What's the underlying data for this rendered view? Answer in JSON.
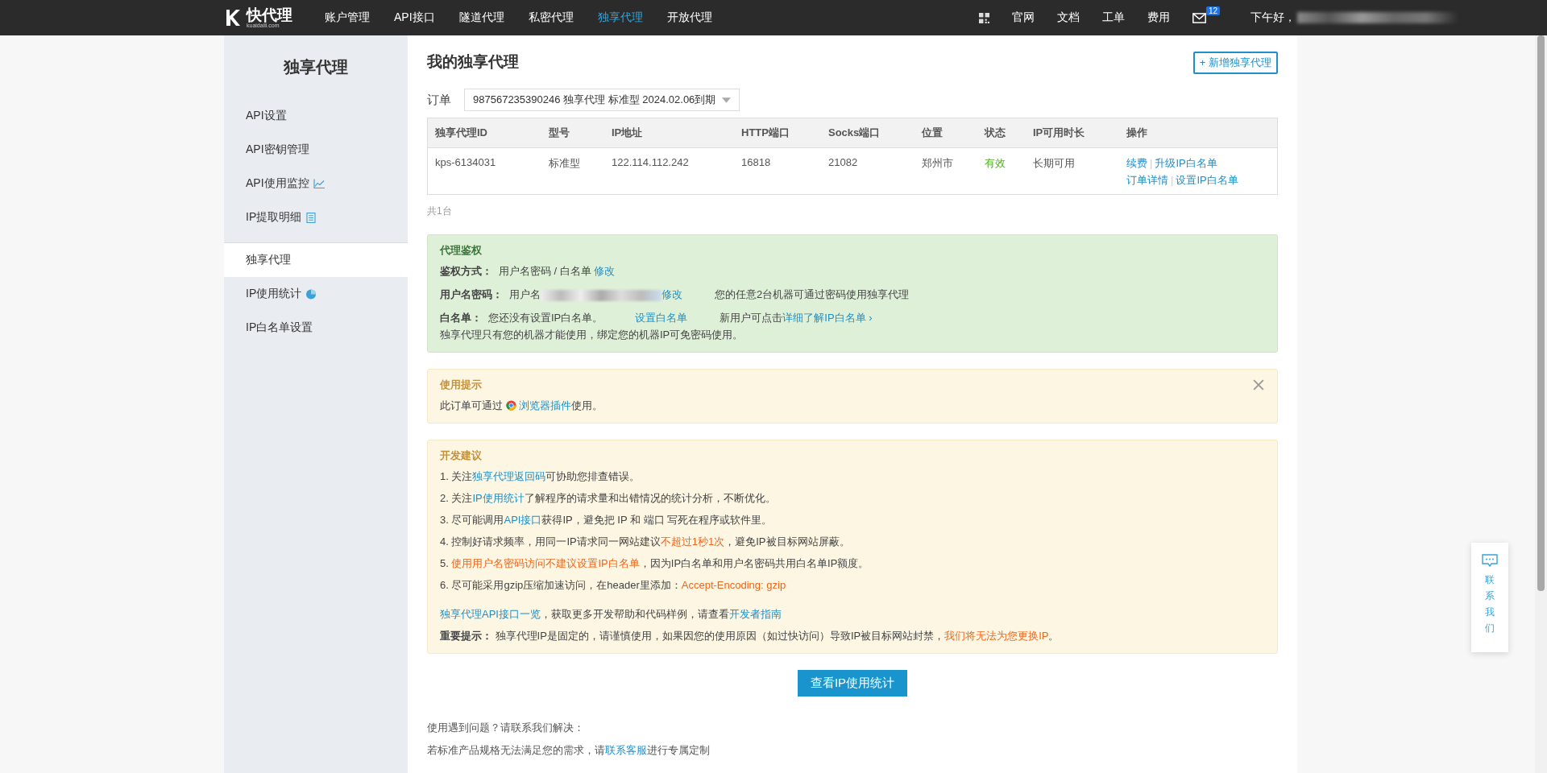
{
  "nav": {
    "logo": {
      "name": "快代理",
      "sub": "kuaidaili.com"
    },
    "menu": [
      {
        "label": "账户管理",
        "selected": false
      },
      {
        "label": "API接口",
        "selected": false
      },
      {
        "label": "隧道代理",
        "selected": false
      },
      {
        "label": "私密代理",
        "selected": false
      },
      {
        "label": "独享代理",
        "selected": true
      },
      {
        "label": "开放代理",
        "selected": false
      }
    ],
    "links": [
      "官网",
      "文档",
      "工单",
      "费用"
    ],
    "mail_badge": "12",
    "greeting": "下午好，"
  },
  "sidebar": {
    "title": "独享代理",
    "groups": [
      [
        {
          "label": "API设置",
          "kind": "plain",
          "selected": false
        },
        {
          "label": "API密钥管理",
          "kind": "plain",
          "selected": false
        },
        {
          "label": "API使用监控",
          "kind": "chart",
          "selected": false
        },
        {
          "label": "IP提取明细",
          "kind": "doc",
          "selected": false
        }
      ],
      [
        {
          "label": "独享代理",
          "kind": "plain",
          "selected": true
        },
        {
          "label": "IP使用统计",
          "kind": "pie",
          "selected": false
        },
        {
          "label": "IP白名单设置",
          "kind": "plain",
          "selected": false
        }
      ]
    ]
  },
  "page": {
    "title": "我的独享代理",
    "add_button": "+ 新增独享代理",
    "order_label": "订单",
    "order_value": "987567235390246  独享代理  标准型  2024.02.06到期"
  },
  "table": {
    "columns": [
      "独享代理ID",
      "型号",
      "IP地址",
      "HTTP端口",
      "Socks端口",
      "位置",
      "状态",
      "IP可用时长",
      "操作"
    ],
    "rows": [
      {
        "cells": [
          "kps-6134031",
          "标准型",
          "122.114.112.242",
          "16818",
          "21082",
          "郑州市",
          "有效",
          "长期可用"
        ],
        "valid": true,
        "actions": [
          [
            "续费",
            "升级IP白名单"
          ],
          [
            "订单详情",
            "设置IP白名单"
          ]
        ],
        "separator": "|"
      }
    ],
    "total": "共1台"
  },
  "auth": {
    "title": "代理鉴权",
    "rows": [
      {
        "label": "鉴权方式：",
        "parts": [
          {
            "kind": "plain",
            "text": "用户名密码 / 白名单 "
          },
          {
            "kind": "link",
            "text": "修改"
          }
        ]
      },
      {
        "label": "用户名密码：",
        "parts": [
          {
            "kind": "plain",
            "text": "用户名"
          },
          {
            "kind": "blur"
          },
          {
            "kind": "link",
            "text": "修改"
          },
          {
            "kind": "gap"
          },
          {
            "kind": "plain",
            "text": "您的任意2台机器可通过密码使用独享代理"
          }
        ]
      },
      {
        "label": "白名单：",
        "parts": [
          {
            "kind": "plain",
            "text": "您还没有设置IP白名单。"
          },
          {
            "kind": "gap"
          },
          {
            "kind": "link",
            "text": "设置白名单"
          },
          {
            "kind": "gap"
          },
          {
            "kind": "plain",
            "text": "新用户可点击"
          },
          {
            "kind": "link",
            "text": "详细了解IP白名单 ›"
          }
        ]
      }
    ],
    "note": "独享代理只有您的机器才能使用，绑定您的机器IP可免密码使用。"
  },
  "usage_tip": {
    "title": "使用提示",
    "parts": [
      {
        "kind": "plain",
        "text": "此订单可通过 "
      },
      {
        "kind": "browser"
      },
      {
        "kind": "link",
        "text": "浏览器插件"
      },
      {
        "kind": "plain",
        "text": "使用。"
      }
    ],
    "closable": true
  },
  "dev_tips": {
    "title": "开发建议",
    "lines": [
      [
        {
          "kind": "plain",
          "text": "1. 关注"
        },
        {
          "kind": "link",
          "text": "独享代理返回码"
        },
        {
          "kind": "plain",
          "text": "可协助您排查错误。"
        }
      ],
      [
        {
          "kind": "plain",
          "text": "2. 关注"
        },
        {
          "kind": "link",
          "text": "IP使用统计"
        },
        {
          "kind": "plain",
          "text": "了解程序的请求量和出错情况的统计分析，不断优化。"
        }
      ],
      [
        {
          "kind": "plain",
          "text": "3. 尽可能调用"
        },
        {
          "kind": "link",
          "text": "API接口"
        },
        {
          "kind": "plain",
          "text": "获得IP，避免把 IP 和 端口 写死在程序或软件里。"
        }
      ],
      [
        {
          "kind": "plain",
          "text": "4. 控制好请求频率，用同一IP请求同一网站建议"
        },
        {
          "kind": "warn",
          "text": "不超过1秒1次"
        },
        {
          "kind": "plain",
          "text": "，避免IP被目标网站屏蔽。"
        }
      ],
      [
        {
          "kind": "plain",
          "text": "5. "
        },
        {
          "kind": "warn",
          "text": "使用用户名密码访问不建议设置IP白名单"
        },
        {
          "kind": "plain",
          "text": "，因为IP白名单和用户名密码共用白名单IP额度。"
        }
      ],
      [
        {
          "kind": "plain",
          "text": "6. 尽可能采用gzip压缩加速访问，在header里添加："
        },
        {
          "kind": "warn",
          "text": "Accept-Encoding: gzip"
        }
      ]
    ],
    "more": [
      {
        "kind": "link",
        "text": "独享代理API接口一览"
      },
      {
        "kind": "plain",
        "text": "，获取更多开发帮助和代码样例，请查看"
      },
      {
        "kind": "link",
        "text": "开发者指南"
      }
    ],
    "important": [
      {
        "kind": "bold",
        "text": "重要提示："
      },
      {
        "kind": "plain",
        "text": "  独享代理IP是固定的，请谨慎使用，如果因您的使用原因（如过快访问）导致IP被目标网站封禁，"
      },
      {
        "kind": "warn",
        "text": "我们将无法为您更换IP"
      },
      {
        "kind": "plain",
        "text": "。"
      }
    ]
  },
  "stats_button": "查看IP使用统计",
  "footer": {
    "question": "使用遇到问题？请联系我们解决：",
    "custom": [
      {
        "kind": "plain",
        "text": "若标准产品规格无法满足您的需求，请"
      },
      {
        "kind": "link",
        "text": "联系客服"
      },
      {
        "kind": "plain",
        "text": "进行专属定制"
      }
    ]
  },
  "contact": {
    "chars": [
      "联",
      "系",
      "我",
      "们"
    ]
  }
}
